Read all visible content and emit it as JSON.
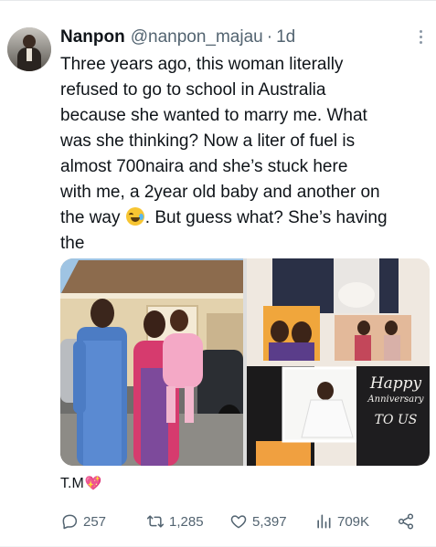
{
  "tweet": {
    "author_name": "Nanpon",
    "handle": "@nanpon_majau",
    "separator": "·",
    "time": "1d",
    "text_lines": [
      "Three years ago, this woman literally",
      "refused to go to school in Australia",
      "because she wanted to marry me. What",
      "was she thinking? Now a liter of fuel is",
      "almost 700naira and she’s stuck here",
      "with me,  a 2year old baby and another on",
      "the way",
      ". But guess what? She’s having",
      "the"
    ],
    "emoji": "rolling-on-floor-laughing-icon",
    "caption": "T.M",
    "caption_emoji": "💖",
    "collage_caption": {
      "line1": "Happy",
      "line2": "Anniversary",
      "line3": "TO US"
    }
  },
  "actions": {
    "replies": "257",
    "retweets": "1,285",
    "likes": "5,397",
    "views": "709K"
  },
  "colors": {
    "text": "#0f1419",
    "secondary": "#536471",
    "divider": "#eff3f4"
  }
}
